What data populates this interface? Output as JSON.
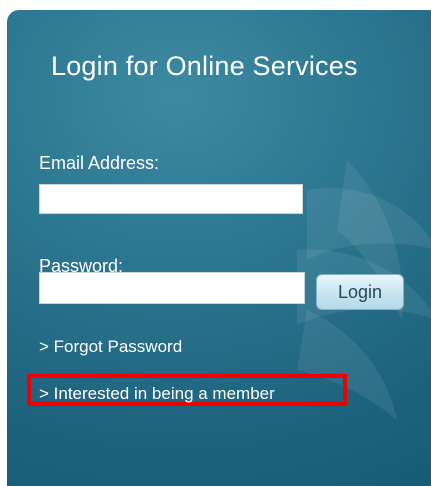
{
  "login_panel": {
    "title": "Login for Online Services",
    "email": {
      "label": "Email Address:",
      "value": "",
      "placeholder": ""
    },
    "password": {
      "label": "Password:",
      "value": "",
      "placeholder": ""
    },
    "login_button_label": "Login",
    "forgot_password_link": "> Forgot Password",
    "member_link": "> Interested in being a member"
  },
  "colors": {
    "panel_teal": "#2b7690",
    "highlight_red": "#ee0000",
    "button_light_blue": "#c7e4ef"
  }
}
